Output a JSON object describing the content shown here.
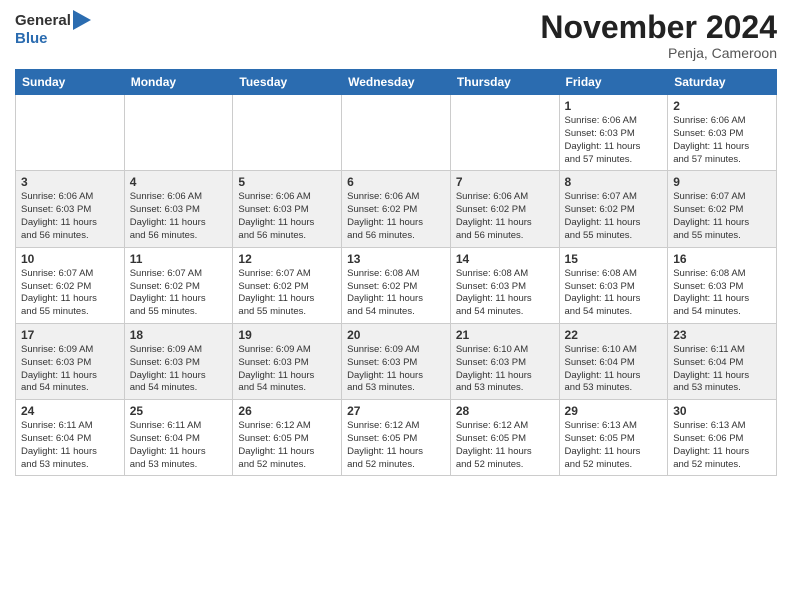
{
  "header": {
    "logo_line1": "General",
    "logo_line2": "Blue",
    "month_title": "November 2024",
    "location": "Penja, Cameroon"
  },
  "weekdays": [
    "Sunday",
    "Monday",
    "Tuesday",
    "Wednesday",
    "Thursday",
    "Friday",
    "Saturday"
  ],
  "weeks": [
    [
      {
        "day": "",
        "info": ""
      },
      {
        "day": "",
        "info": ""
      },
      {
        "day": "",
        "info": ""
      },
      {
        "day": "",
        "info": ""
      },
      {
        "day": "",
        "info": ""
      },
      {
        "day": "1",
        "info": "Sunrise: 6:06 AM\nSunset: 6:03 PM\nDaylight: 11 hours\nand 57 minutes."
      },
      {
        "day": "2",
        "info": "Sunrise: 6:06 AM\nSunset: 6:03 PM\nDaylight: 11 hours\nand 57 minutes."
      }
    ],
    [
      {
        "day": "3",
        "info": "Sunrise: 6:06 AM\nSunset: 6:03 PM\nDaylight: 11 hours\nand 56 minutes."
      },
      {
        "day": "4",
        "info": "Sunrise: 6:06 AM\nSunset: 6:03 PM\nDaylight: 11 hours\nand 56 minutes."
      },
      {
        "day": "5",
        "info": "Sunrise: 6:06 AM\nSunset: 6:03 PM\nDaylight: 11 hours\nand 56 minutes."
      },
      {
        "day": "6",
        "info": "Sunrise: 6:06 AM\nSunset: 6:02 PM\nDaylight: 11 hours\nand 56 minutes."
      },
      {
        "day": "7",
        "info": "Sunrise: 6:06 AM\nSunset: 6:02 PM\nDaylight: 11 hours\nand 56 minutes."
      },
      {
        "day": "8",
        "info": "Sunrise: 6:07 AM\nSunset: 6:02 PM\nDaylight: 11 hours\nand 55 minutes."
      },
      {
        "day": "9",
        "info": "Sunrise: 6:07 AM\nSunset: 6:02 PM\nDaylight: 11 hours\nand 55 minutes."
      }
    ],
    [
      {
        "day": "10",
        "info": "Sunrise: 6:07 AM\nSunset: 6:02 PM\nDaylight: 11 hours\nand 55 minutes."
      },
      {
        "day": "11",
        "info": "Sunrise: 6:07 AM\nSunset: 6:02 PM\nDaylight: 11 hours\nand 55 minutes."
      },
      {
        "day": "12",
        "info": "Sunrise: 6:07 AM\nSunset: 6:02 PM\nDaylight: 11 hours\nand 55 minutes."
      },
      {
        "day": "13",
        "info": "Sunrise: 6:08 AM\nSunset: 6:02 PM\nDaylight: 11 hours\nand 54 minutes."
      },
      {
        "day": "14",
        "info": "Sunrise: 6:08 AM\nSunset: 6:03 PM\nDaylight: 11 hours\nand 54 minutes."
      },
      {
        "day": "15",
        "info": "Sunrise: 6:08 AM\nSunset: 6:03 PM\nDaylight: 11 hours\nand 54 minutes."
      },
      {
        "day": "16",
        "info": "Sunrise: 6:08 AM\nSunset: 6:03 PM\nDaylight: 11 hours\nand 54 minutes."
      }
    ],
    [
      {
        "day": "17",
        "info": "Sunrise: 6:09 AM\nSunset: 6:03 PM\nDaylight: 11 hours\nand 54 minutes."
      },
      {
        "day": "18",
        "info": "Sunrise: 6:09 AM\nSunset: 6:03 PM\nDaylight: 11 hours\nand 54 minutes."
      },
      {
        "day": "19",
        "info": "Sunrise: 6:09 AM\nSunset: 6:03 PM\nDaylight: 11 hours\nand 54 minutes."
      },
      {
        "day": "20",
        "info": "Sunrise: 6:09 AM\nSunset: 6:03 PM\nDaylight: 11 hours\nand 53 minutes."
      },
      {
        "day": "21",
        "info": "Sunrise: 6:10 AM\nSunset: 6:03 PM\nDaylight: 11 hours\nand 53 minutes."
      },
      {
        "day": "22",
        "info": "Sunrise: 6:10 AM\nSunset: 6:04 PM\nDaylight: 11 hours\nand 53 minutes."
      },
      {
        "day": "23",
        "info": "Sunrise: 6:11 AM\nSunset: 6:04 PM\nDaylight: 11 hours\nand 53 minutes."
      }
    ],
    [
      {
        "day": "24",
        "info": "Sunrise: 6:11 AM\nSunset: 6:04 PM\nDaylight: 11 hours\nand 53 minutes."
      },
      {
        "day": "25",
        "info": "Sunrise: 6:11 AM\nSunset: 6:04 PM\nDaylight: 11 hours\nand 53 minutes."
      },
      {
        "day": "26",
        "info": "Sunrise: 6:12 AM\nSunset: 6:05 PM\nDaylight: 11 hours\nand 52 minutes."
      },
      {
        "day": "27",
        "info": "Sunrise: 6:12 AM\nSunset: 6:05 PM\nDaylight: 11 hours\nand 52 minutes."
      },
      {
        "day": "28",
        "info": "Sunrise: 6:12 AM\nSunset: 6:05 PM\nDaylight: 11 hours\nand 52 minutes."
      },
      {
        "day": "29",
        "info": "Sunrise: 6:13 AM\nSunset: 6:05 PM\nDaylight: 11 hours\nand 52 minutes."
      },
      {
        "day": "30",
        "info": "Sunrise: 6:13 AM\nSunset: 6:06 PM\nDaylight: 11 hours\nand 52 minutes."
      }
    ]
  ]
}
